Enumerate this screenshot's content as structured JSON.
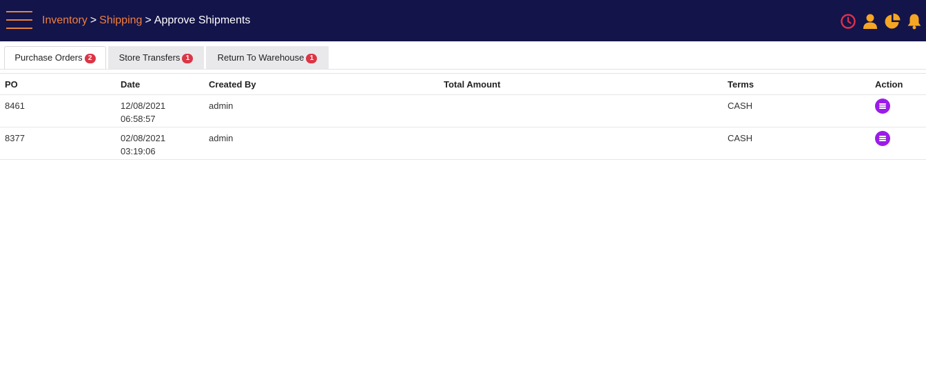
{
  "header": {
    "breadcrumb": {
      "items": [
        "Inventory",
        "Shipping"
      ],
      "separator": ">",
      "current": "Approve Shipments"
    },
    "icons": [
      "clock-icon",
      "user-icon",
      "pie-chart-icon",
      "bell-icon"
    ],
    "colors": {
      "background": "#13144a",
      "accent": "#f27f3d",
      "clock": "#e0304a",
      "icon": "#f5a623"
    }
  },
  "tabs": [
    {
      "label": "Purchase Orders",
      "badge": "2",
      "active": true
    },
    {
      "label": "Store Transfers",
      "badge": "1",
      "active": false
    },
    {
      "label": "Return To Warehouse",
      "badge": "1",
      "active": false
    }
  ],
  "table": {
    "columns": [
      "PO",
      "Date",
      "Created By",
      "Total Amount",
      "Terms",
      "Action"
    ],
    "rows": [
      {
        "po": "8461",
        "date": "12/08/2021",
        "time": "06:58:57",
        "created_by": "admin",
        "total_amount": "",
        "terms": "CASH",
        "action_icon": "list-icon"
      },
      {
        "po": "8377",
        "date": "02/08/2021",
        "time": "03:19:06",
        "created_by": "admin",
        "total_amount": "",
        "terms": "CASH",
        "action_icon": "list-icon"
      }
    ]
  }
}
